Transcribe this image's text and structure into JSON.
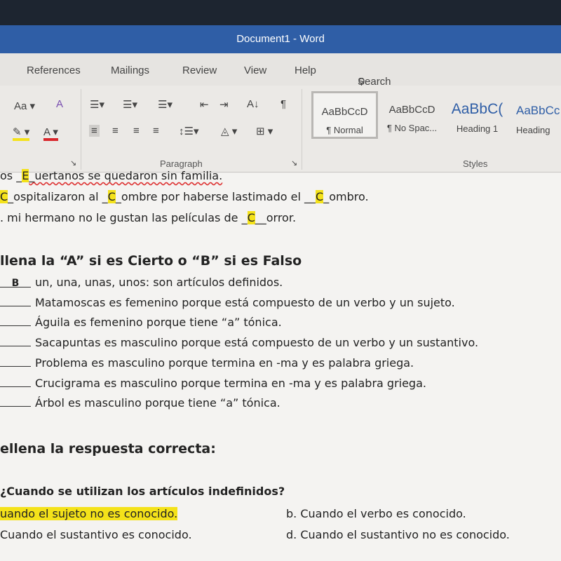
{
  "window": {
    "title": "Document1 - Word"
  },
  "menu": {
    "items": [
      "References",
      "Mailings",
      "Review",
      "View",
      "Help"
    ],
    "search": "Search"
  },
  "ribbon": {
    "font_case": "Aa",
    "paragraph_label": "Paragraph",
    "styles_label": "Styles",
    "styles": [
      {
        "preview": "AaBbCcD",
        "name": "¶ Normal"
      },
      {
        "preview": "AaBbCcD",
        "name": "¶ No Spac..."
      },
      {
        "preview": "AaBbC(",
        "name": "Heading 1"
      },
      {
        "preview": "AaBbCc",
        "name": "Heading"
      }
    ],
    "highlight_color": "#f4e21a",
    "font_color": "#d9262b"
  },
  "document": {
    "lines_top": [
      {
        "pre": "os _",
        "ans": "E",
        "post": "_uertanos se quedaron sin familia."
      },
      {
        "pre": "",
        "ans": "C",
        "post": "_ospitalizaron al _",
        "ans2": "C",
        "post2": "_ombre por haberse lastimado el __",
        "ans3": "C",
        "post3": "_ombro."
      },
      {
        "pre": ". mi hermano no le gustan las películas de _",
        "ans": "C",
        "post": "__orror."
      }
    ],
    "section2_title": "llena la “A” si es Cierto o “B” si es Falso",
    "tf": [
      {
        "answer": "B",
        "text": "un, una, unas, unos: son artículos definidos."
      },
      {
        "answer": "",
        "text": "Matamoscas es femenino porque está compuesto de un verbo y un sujeto."
      },
      {
        "answer": "",
        "text": "Águila es femenino porque tiene “a” tónica."
      },
      {
        "answer": "",
        "text": "Sacapuntas es masculino porque está compuesto de un verbo y un sustantivo."
      },
      {
        "answer": "",
        "text": "Problema es masculino porque termina en -ma y es palabra griega."
      },
      {
        "answer": "",
        "text": "Crucigrama es masculino porque termina en -ma y es palabra griega."
      },
      {
        "answer": "",
        "text": "Árbol es masculino porque tiene “a” tónica."
      }
    ],
    "section3_title": "ellena la respuesta correcta:",
    "question": "¿Cuando se utilizan los artículos indefinidos?",
    "options": {
      "a": "uando el sujeto no es conocido.",
      "b": "b. Cuando el verbo es conocido.",
      "c": "Cuando el sustantivo es conocido.",
      "d": "d. Cuando el sustantivo no es conocido."
    }
  }
}
